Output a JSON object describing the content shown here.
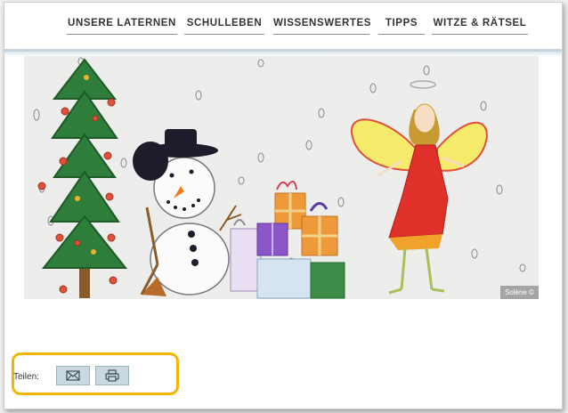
{
  "nav": {
    "items": [
      {
        "label": "UNSERE LATERNEN"
      },
      {
        "label": "SCHULLEBEN"
      },
      {
        "label": "WISSENSWERTES"
      },
      {
        "label": "TIPPS"
      },
      {
        "label": "WITZE & RÄTSEL"
      }
    ]
  },
  "hero": {
    "credit": "Solène ©"
  },
  "share": {
    "label": "Teilen:",
    "buttons": [
      {
        "icon": "envelope-icon"
      },
      {
        "icon": "printer-icon"
      }
    ]
  },
  "colors": {
    "highlight": "#f5b400",
    "button_bg": "#cad8e0",
    "nav_text": "#333333"
  }
}
